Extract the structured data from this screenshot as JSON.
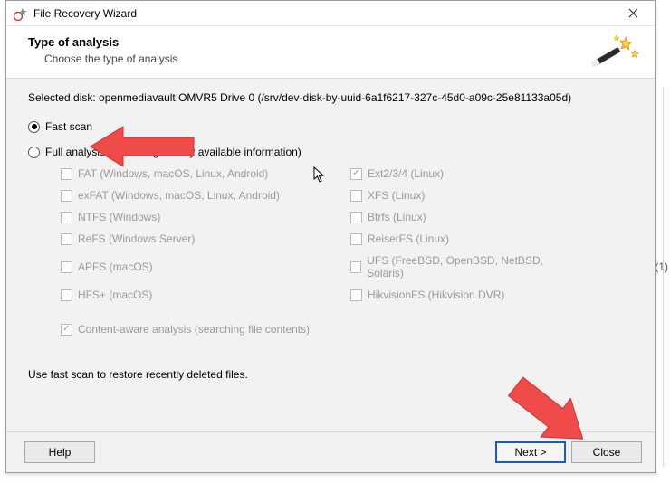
{
  "window": {
    "title": "File Recovery Wizard"
  },
  "header": {
    "title": "Type of analysis",
    "subtitle": "Choose the type of analysis"
  },
  "selected_disk_label": "Selected disk: openmediavault:OMVR5 Drive 0 (/srv/dev-disk-by-uuid-6a1f6217-327c-45d0-a09c-25e81133a05d)",
  "options": {
    "fast_scan": "Fast scan",
    "full_analysis": "Full analysis (searching for any available information)"
  },
  "filesystems_left": [
    {
      "label": "FAT (Windows, macOS, Linux, Android)",
      "checked": false
    },
    {
      "label": "exFAT (Windows, macOS, Linux, Android)",
      "checked": false
    },
    {
      "label": "NTFS (Windows)",
      "checked": false
    },
    {
      "label": "ReFS (Windows Server)",
      "checked": false
    },
    {
      "label": "APFS (macOS)",
      "checked": false
    },
    {
      "label": "HFS+ (macOS)",
      "checked": false
    }
  ],
  "filesystems_right": [
    {
      "label": "Ext2/3/4 (Linux)",
      "checked": true
    },
    {
      "label": "XFS (Linux)",
      "checked": false
    },
    {
      "label": "Btrfs (Linux)",
      "checked": false
    },
    {
      "label": "ReiserFS (Linux)",
      "checked": false
    },
    {
      "label": "UFS (FreeBSD, OpenBSD, NetBSD, Solaris)",
      "checked": false
    },
    {
      "label": "HikvisionFS (Hikvision DVR)",
      "checked": false
    }
  ],
  "content_aware": {
    "label": "Content-aware analysis (searching file contents)",
    "checked": true
  },
  "hint": "Use fast scan to restore recently deleted files.",
  "buttons": {
    "help": "Help",
    "next": "Next >",
    "close": "Close"
  },
  "bg_count": "(1)"
}
